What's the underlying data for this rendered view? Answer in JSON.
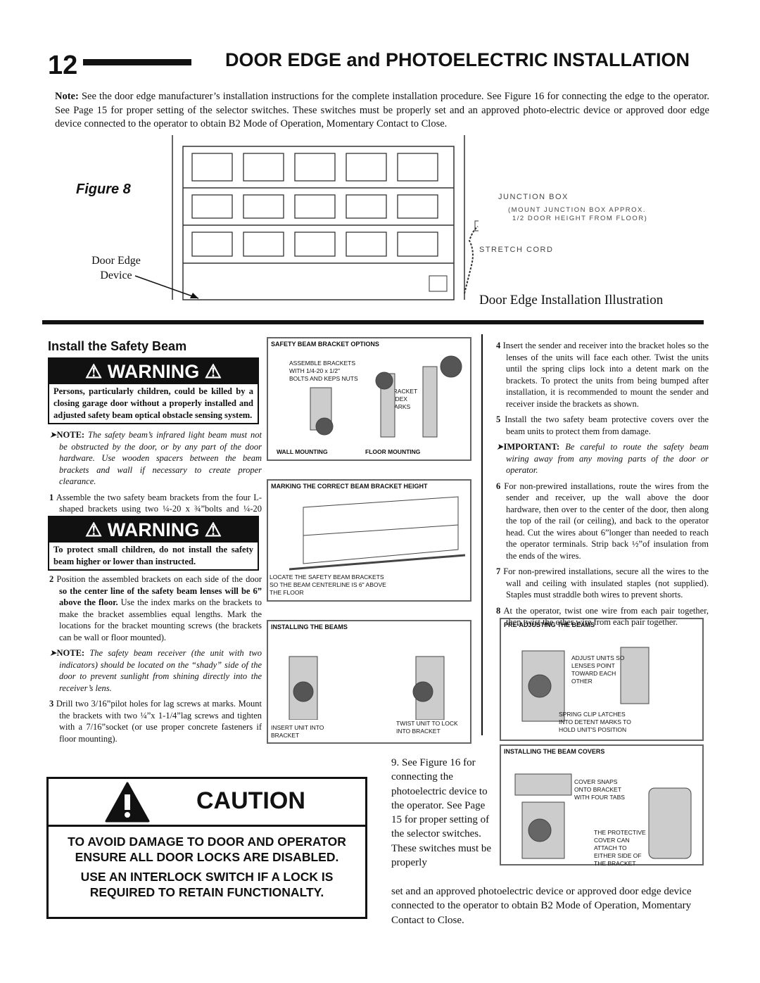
{
  "header": {
    "page_number": "12",
    "title": "DOOR EDGE and PHOTOELECTRIC INSTALLATION"
  },
  "note": {
    "label": "Note:",
    "text": " See the door edge manufacturer’s installation instructions for the complete installation procedure.  See Figure 16 for connecting the edge to the operator.  See Page 15 for proper setting of the selector switches.  These switches must be properly set and an approved photo-electric device or approved door edge device connected to the operator to obtain B2 Mode of Operation, Momentary Contact to Close."
  },
  "figure8": {
    "label": "Figure 8",
    "door_edge": "Door Edge",
    "device": "Device",
    "junction_box": "JUNCTION BOX",
    "junction_note_1": "(MOUNT JUNCTION BOX APPROX.",
    "junction_note_2": "1/2 DOOR HEIGHT FROM FLOOR)",
    "stretch_cord": "STRETCH CORD",
    "caption": "Door Edge Installation Illustration"
  },
  "section": {
    "title": "Install the Safety Beam"
  },
  "warning1": {
    "heading": "WARNING",
    "text": "Persons, particularly children, could be killed by a closing garage door without a properly installed and adjusted safety beam optical obstacle sensing system."
  },
  "note1": {
    "label": "NOTE:",
    "text": " The safety beam’s infrared light beam must not be obstructed by the door, or by any part of the door hardware. Use wooden spacers between the beam brackets and wall if necessary to create proper clearance."
  },
  "step1": {
    "num": "1",
    "text": "Assemble the two safety beam brackets from the four L-shaped brackets using two ¼-20 x ¾”bolts and ¼-20 keps nuts (one nut & bolt for each bracket)."
  },
  "warning2": {
    "heading": "WARNING",
    "text": "To protect small children, do not install the safety beam higher or lower than instructed."
  },
  "step2": {
    "num": "2",
    "text_a": "Position the assembled brackets on each side of the door ",
    "bold": "so the center line of the safety beam lenses will be 6” above the floor.",
    "text_b": " Use the index marks on the brackets to make the bracket assemblies equal lengths. Mark the locations for the bracket mounting screws (the brackets can be wall or floor mounted)."
  },
  "note2": {
    "label": "NOTE:",
    "text": " The safety beam receiver (the unit with two indicators) should be located on the “shady” side of the door to prevent sunlight from shining directly into the receiver’s lens."
  },
  "step3": {
    "num": "3",
    "text": "Drill two 3/16”pilot holes for lag screws at marks. Mount the brackets with two ¼”x 1-1/4”lag screws and tighten with a 7/16”socket (or use proper concrete fasteners if floor mounting)."
  },
  "fig_options": {
    "title": "SAFETY BEAM BRACKET OPTIONS",
    "assemble": "ASSEMBLE BRACKETS WITH 1/4-20 x 1/2\" BOLTS AND KEPS NUTS",
    "index": "BRACKET INDEX MARKS",
    "wall": "WALL MOUNTING",
    "floor": "FLOOR MOUNTING"
  },
  "fig_height": {
    "title": "MARKING THE CORRECT BEAM BRACKET HEIGHT",
    "label": "LOCATE THE SAFETY BEAM BRACKETS SO THE BEAM CENTERLINE IS 6\" ABOVE THE FLOOR"
  },
  "fig_install": {
    "title": "INSTALLING THE BEAMS",
    "insert": "INSERT UNIT INTO BRACKET",
    "twist": "TWIST UNIT TO LOCK INTO BRACKET"
  },
  "fig_adjust": {
    "title": "PRE-ADJUSTING THE BEAMS",
    "adjust": "ADJUST UNITS SO LENSES POINT TOWARD EACH OTHER",
    "spring": "SPRING CLIP LATCHES INTO DETENT MARKS TO HOLD UNIT'S POSITION"
  },
  "fig_covers": {
    "title": "INSTALLING THE BEAM COVERS",
    "snaps": "COVER SNAPS ONTO BRACKET WITH FOUR TABS",
    "attach": "THE PROTECTIVE COVER CAN ATTACH TO EITHER SIDE OF THE BRACKET"
  },
  "step4": {
    "num": "4",
    "text": "Insert the sender and receiver into the bracket holes so the lenses of the units will face each other. Twist the units until the spring clips lock into a detent mark on the brackets. To protect the units from being bumped after installation, it is recommended to mount the sender and receiver inside the brackets as shown."
  },
  "step5": {
    "num": "5",
    "text": "Install the two safety beam protective covers over the beam units to protect them from damage."
  },
  "important": {
    "label": "IMPORTANT:",
    "text": " Be careful to route the safety beam wiring away from any moving parts of the door or operator."
  },
  "step6": {
    "num": "6",
    "text": "For non-prewired installations, route the wires from the sender and receiver, up the wall above the door hardware, then over to the center of the door, then along the top of the rail (or ceiling), and back to the operator head. Cut the wires about 6”longer than needed to reach the operator terminals. Strip back ½”of insulation from the ends of the wires."
  },
  "step7": {
    "num": "7",
    "text": "For non-prewired installations, secure all the wires to the wall and ceiling with insulated staples (not supplied). Staples must straddle both wires to prevent shorts."
  },
  "step8": {
    "num": "8",
    "text": "At the operator, twist one wire from each pair together, then twist the other wire from each pair together."
  },
  "step9": {
    "text_a": "9. See Figure 16 for connecting the photoelectric device to the operator.  See Page 15 for proper setting of the selector switches. These switches must be properly",
    "text_b": "set and an approved photoelectric device or approved door edge device connected to the operator to obtain B2 Mode of Operation, Momentary Contact to Close."
  },
  "caution": {
    "heading": "CAUTION",
    "line1": "TO AVOID DAMAGE TO DOOR AND OPERATOR ENSURE ALL DOOR LOCKS ARE DISABLED.",
    "line2": "USE AN INTERLOCK SWITCH IF A LOCK IS REQUIRED TO RETAIN FUNCTIONALTY."
  }
}
